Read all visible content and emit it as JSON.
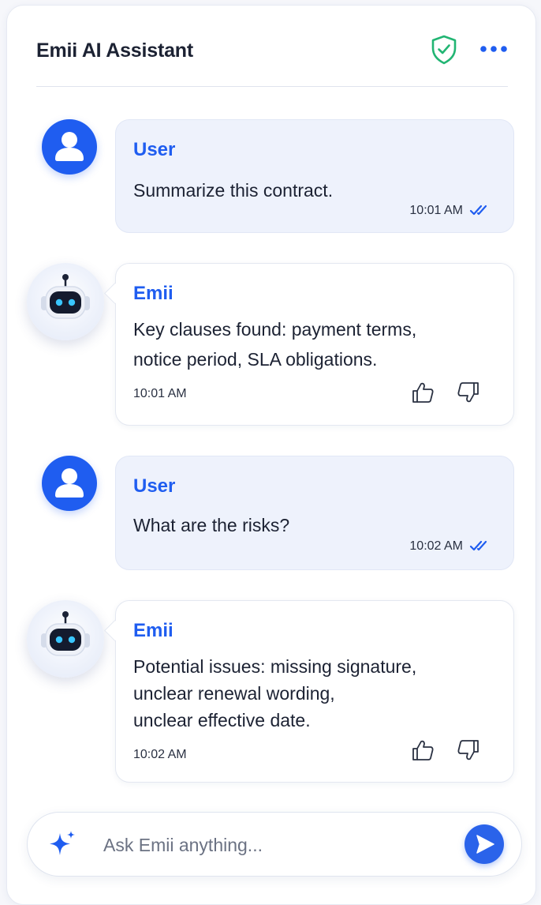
{
  "header": {
    "title": "Emii AI Assistant",
    "shield_icon": "shield-check-icon",
    "menu_icon": "more-horizontal-icon"
  },
  "colors": {
    "accent": "#1f5df0",
    "shield": "#22b573",
    "user_bubble": "#eef2fc",
    "text": "#1c2233"
  },
  "messages": [
    {
      "role": "user",
      "sender": "User",
      "text": "Summarize this contract.",
      "time": "10:01 AM",
      "status_icon": "double-check-icon"
    },
    {
      "role": "assistant",
      "sender": "Emii",
      "lines": [
        "Key clauses found: payment terms,",
        "notice period, SLA obligations."
      ],
      "time": "10:01 AM",
      "feedback_icons": [
        "thumbs-up-icon",
        "thumbs-down-icon"
      ]
    },
    {
      "role": "user",
      "sender": "User",
      "text": "What are the risks?",
      "time": "10:02 AM",
      "status_icon": "double-check-icon"
    },
    {
      "role": "assistant",
      "sender": "Emii",
      "lines": [
        "Potential issues: missing signature,",
        "unclear renewal wording,",
        "unclear effective date."
      ],
      "time": "10:02 AM",
      "feedback_icons": [
        "thumbs-up-icon",
        "thumbs-down-icon"
      ]
    }
  ],
  "composer": {
    "placeholder": "Ask Emii anything...",
    "value": "",
    "leading_icon": "sparkle-icon",
    "send_icon": "send-icon"
  }
}
